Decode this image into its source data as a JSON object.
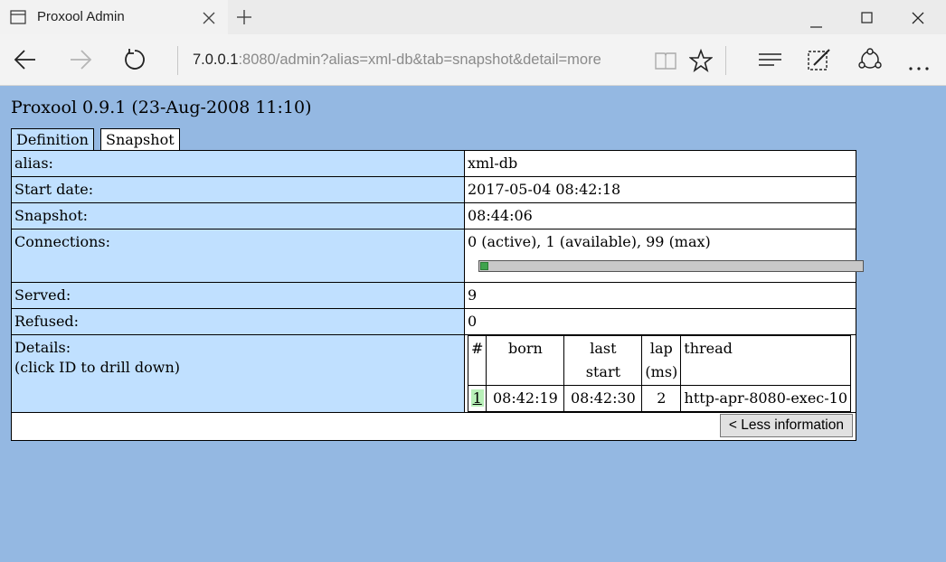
{
  "browser": {
    "tab_title": "Proxool Admin",
    "url_host": "7.0.0.1",
    "url_rest": ":8080/admin?alias=xml-db&tab=snapshot&detail=more",
    "icons": [
      "page-icon",
      "close-icon",
      "new-tab-icon",
      "minimize-icon",
      "maximize-icon",
      "window-close-icon",
      "back-icon",
      "forward-icon",
      "refresh-icon",
      "reading-view-icon",
      "favorite-star-icon",
      "hub-icon",
      "web-note-icon",
      "share-icon",
      "more-icon"
    ]
  },
  "page": {
    "heading": "Proxool 0.9.1 (23-Aug-2008 11:10)",
    "tabs": [
      {
        "label": "Definition"
      },
      {
        "label": "Snapshot"
      }
    ],
    "rows": {
      "alias": {
        "label": "alias:",
        "value": "xml-db"
      },
      "start_date": {
        "label": "Start date:",
        "value": "2017-05-04 08:42:18"
      },
      "snapshot": {
        "label": "Snapshot:",
        "value": "08:44:06"
      },
      "connections": {
        "label": "Connections:",
        "value": "0 (active), 1 (available), 99 (max)",
        "available_fraction": 0.01,
        "bar_fill_color": "#3fa34d"
      },
      "served": {
        "label": "Served:",
        "value": "9"
      },
      "refused": {
        "label": "Refused:",
        "value": "0"
      },
      "details": {
        "label": "Details:",
        "sublabel": "(click ID to drill down)"
      }
    },
    "details_table": {
      "headers": {
        "id": "#",
        "born": "born",
        "last1": "last",
        "last2": "start",
        "lap1": "lap",
        "lap2": "(ms)",
        "thread": "thread"
      },
      "rows": [
        {
          "id": "1",
          "born": "08:42:19",
          "last_start": "08:42:30",
          "lap": "2",
          "thread": "http-apr-8080-exec-10"
        }
      ]
    },
    "less_button": "< Less information",
    "colors": {
      "background": "#94b8e2",
      "label_cell": "#c0e0ff"
    }
  }
}
